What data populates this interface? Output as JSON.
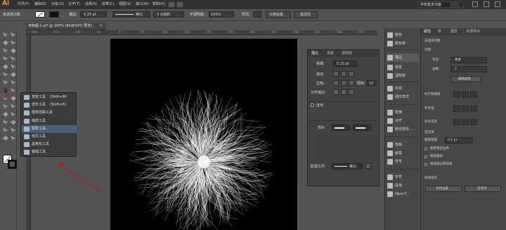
{
  "app": {
    "logo": "Ai",
    "workspace": "传统基本功能"
  },
  "menubar": [
    "文件(F)",
    "编辑(E)",
    "对象(O)",
    "文字(T)",
    "选择(S)",
    "效果(C)",
    "视图(V)",
    "窗口(W)",
    "帮助(H)"
  ],
  "controlbar": {
    "selection": "未选择对象",
    "stroke_label": "描边:",
    "stroke_value": "0.25 pt",
    "profile_label": "等比",
    "brush_label": "3 点圆形",
    "opacity_label": "不透明度:",
    "opacity_value": "100%",
    "style_label": "样式:",
    "doc_setup": "文档设置",
    "preferences": "首选项"
  },
  "document": {
    "tab": "未标题-1.ai* @ 100% (RGB/GPU 预览)",
    "close": "×"
  },
  "ruler_ticks": [
    "200",
    "150",
    "100",
    "50",
    "0",
    "50",
    "100",
    "150",
    "200",
    "250",
    "300",
    "350",
    "400",
    "450",
    "500",
    "550"
  ],
  "flyout": [
    {
      "label": "宽度工具",
      "key": "(Shift+W)"
    },
    {
      "label": "变形工具",
      "key": "(Shift+R)"
    },
    {
      "label": "旋转扭曲工具",
      "key": ""
    },
    {
      "label": "缩拢工具",
      "key": ""
    },
    {
      "label": "膨胀工具",
      "key": ""
    },
    {
      "label": "扇贝工具",
      "key": ""
    },
    {
      "label": "晶格化工具",
      "key": ""
    },
    {
      "label": "皱褶工具",
      "key": ""
    }
  ],
  "stroke_panel": {
    "tabs": [
      "描边",
      "渐变",
      "透明度"
    ],
    "weight_label": "粗细:",
    "weight_value": "0.25 pt",
    "cap_label": "端点:",
    "corner_label": "边角:",
    "limit_label": "限制:",
    "limit_value": "10",
    "align_label": "对齐描边:",
    "dashed_label": "虚线",
    "arrow_label": "箭头:",
    "profile_label": "配置文件:",
    "profile_value": "等比"
  },
  "icon_panel": [
    "颜色",
    "颜色参...",
    "描边",
    "渐变",
    "透明度",
    "外观",
    "图形样式",
    "变换",
    "对齐",
    "路径查找...",
    "色板",
    "画笔",
    "符号",
    "字符",
    "段落",
    "OpenT..."
  ],
  "properties": {
    "tabs": [
      "属性",
      "库",
      "图层",
      "资源导出"
    ],
    "no_selection": "未选择对象",
    "doc_label": "文档",
    "unit_label": "单位:",
    "unit_value": "像素",
    "artboard_label": "画板:",
    "artboard_value": "1",
    "edit_artboard": "编辑画板",
    "ruler_grid": "标尺和网格",
    "guides": "参考线",
    "snap": "对齐选项",
    "preferences": "首选项",
    "keyboard_increment": "键盘增量:",
    "keyboard_value": "0.1 pt",
    "scale_corners": "使用预览边界",
    "scale_strokes": "缩放圆角",
    "scale_effects": "缩放描边和效果",
    "quick_actions": "快速操作",
    "doc_setup": "文档设置",
    "prefs_btn": "首选项"
  }
}
